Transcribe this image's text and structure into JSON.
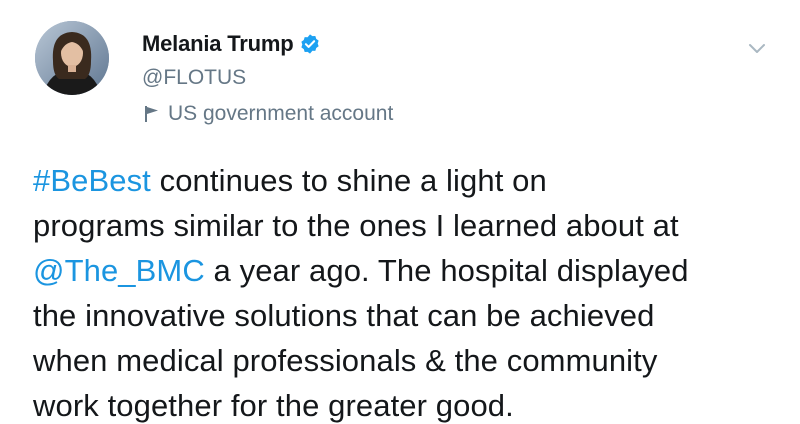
{
  "user": {
    "display_name": "Melania Trump",
    "handle": "@FLOTUS",
    "account_label": "US government account",
    "verified": true
  },
  "icons": {
    "verified": "verified-badge-icon",
    "flag": "flag-icon",
    "more": "chevron-down-icon"
  },
  "colors": {
    "link": "#1b95e0",
    "text": "#14171a",
    "secondary": "#657786",
    "verified": "#1da1f2"
  },
  "tweet": {
    "line1": {
      "hashtag": "#BeBest",
      "text": " continues to shine a light on"
    },
    "line2": {
      "text": "programs similar to the ones I learned about at"
    },
    "line3": {
      "mention": "@The_BMC",
      "text": " a year ago. The hospital displayed"
    },
    "line4": {
      "text": "the innovative solutions that can be achieved"
    },
    "line5": {
      "text": "when medical professionals & the community"
    },
    "line6": {
      "text": "work together for the greater good."
    }
  }
}
